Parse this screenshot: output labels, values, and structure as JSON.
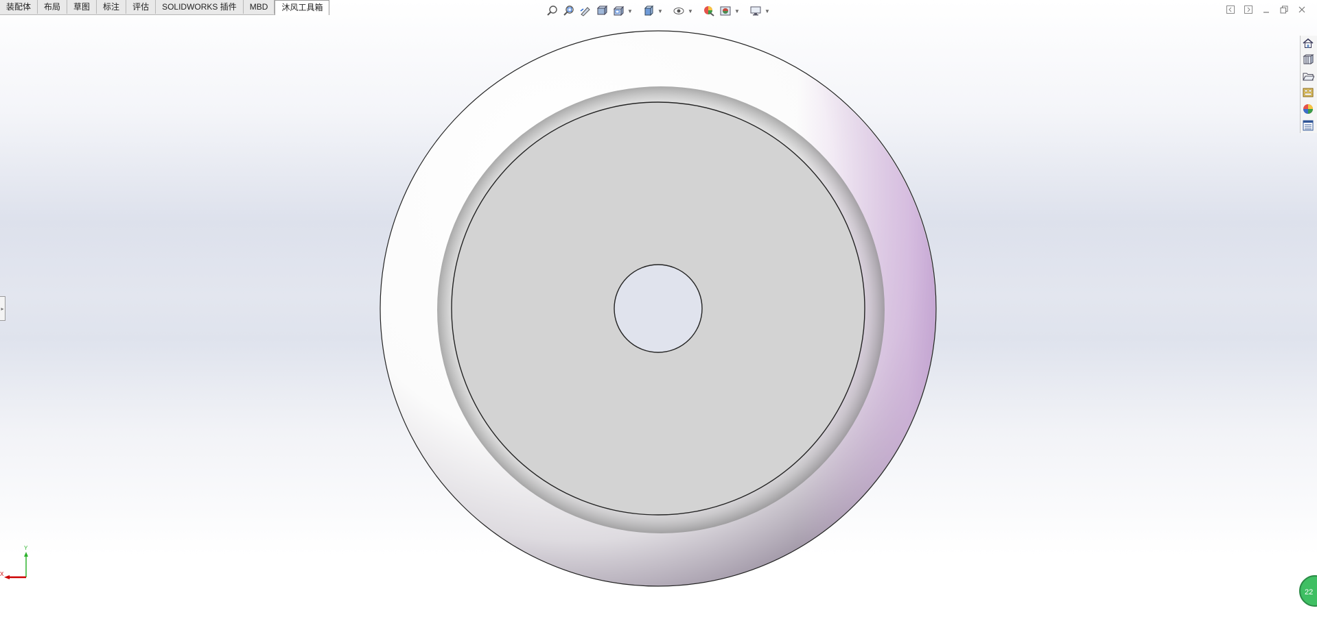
{
  "tabs": [
    {
      "label": "装配体",
      "name": "tab-assembly"
    },
    {
      "label": "布局",
      "name": "tab-layout"
    },
    {
      "label": "草图",
      "name": "tab-sketch"
    },
    {
      "label": "标注",
      "name": "tab-markup"
    },
    {
      "label": "评估",
      "name": "tab-evaluate"
    },
    {
      "label": "SOLIDWORKS 插件",
      "name": "tab-solidworks-addins"
    },
    {
      "label": "MBD",
      "name": "tab-mbd"
    },
    {
      "label": "沐风工具箱",
      "name": "tab-mufeng-toolbox",
      "active": true
    }
  ],
  "heads_up_toolbar": [
    "zoom-to-fit-icon",
    "zoom-to-area-icon",
    "previous-view-icon",
    "section-view-icon",
    "dynamic-annotation-view-icon",
    "view-orientation-icon",
    "display-style-icon",
    "hide-show-items-icon",
    "edit-appearance-icon",
    "apply-scene-icon",
    "view-settings-icon"
  ],
  "window_controls": [
    "tile-left-icon",
    "tile-right-icon",
    "minimize-icon",
    "restore-icon",
    "close-icon"
  ],
  "task_pane": [
    "home-icon",
    "design-library-icon",
    "file-explorer-icon",
    "view-palette-icon",
    "appearances-icon",
    "custom-properties-icon"
  ],
  "triad": {
    "x_label": "X",
    "y_label": "Y"
  },
  "badge": {
    "text": "22"
  },
  "colors": {
    "accent_triad_x": "#cc0000",
    "accent_triad_y": "#2db32d",
    "face_gray": "#d3d3d3",
    "badge_green": "#3fbf63"
  }
}
